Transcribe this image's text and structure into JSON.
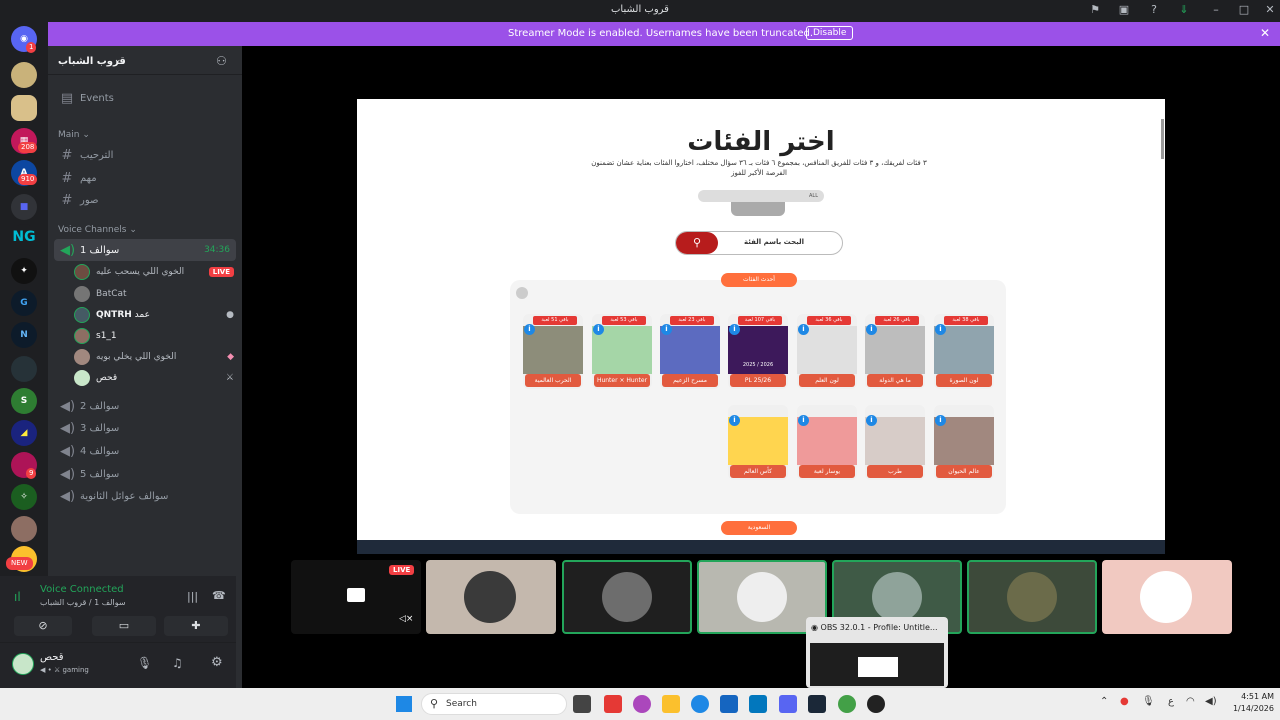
{
  "window": {
    "title": "قروب الشباب"
  },
  "banner": {
    "text": "Streamer Mode is enabled. Usernames have been truncated.",
    "disable_label": "Disable"
  },
  "servers": [
    {
      "badge": "1"
    },
    {
      "badge": ""
    },
    {
      "badge": ""
    },
    {
      "badge": "208"
    },
    {
      "badge": "910"
    },
    {
      "badge": ""
    },
    {
      "label": "NG"
    },
    {
      "badge": ""
    },
    {
      "badge": ""
    },
    {
      "badge": ""
    },
    {
      "badge": ""
    },
    {
      "badge": ""
    },
    {
      "badge": "9"
    },
    {
      "badge": ""
    },
    {
      "badge": ""
    },
    {
      "label": "NEW"
    }
  ],
  "sidebar": {
    "server_name": "قروب الشباب",
    "events_label": "Events",
    "main_category": "Main",
    "text_channels": [
      "الترحيب",
      "مهم",
      "صور"
    ],
    "voice_category": "Voice Channels",
    "active_voice": {
      "name": "سوالف 1",
      "timer": "34:36"
    },
    "voice_users": [
      {
        "name": "الخوي اللي يسحب عليه",
        "live": "LIVE"
      },
      {
        "name": "BatCat"
      },
      {
        "name": "QNTRH",
        "extra": "عمد"
      },
      {
        "name": "s1_1"
      },
      {
        "name": "الخوي اللي يخلي بويه"
      },
      {
        "name": "قحص"
      }
    ],
    "other_voice": [
      "سوالف 2",
      "سوالف 3",
      "سوالف 4",
      "سوالف 5",
      "سوالف عوائل الثانوية"
    ]
  },
  "voice_panel": {
    "status": "Voice Connected",
    "location": "سوالف 1 / قروب الشباب"
  },
  "user_panel": {
    "name": "قحص",
    "status": "gaming"
  },
  "stream": {
    "page_title": "اختر الفئات",
    "subtitle": "٣ فئات لفريقك، و ٣ فئات للفريق المنافس، بمجموع ٦ فئات بـ ٣٦ سؤال مختلف، اختاروا الفئات بعناية عشان تضمنون الفرصة الأكبر للفوز",
    "search_placeholder": "البحث باسم الفئة",
    "filter_all": "ALL",
    "section1": "أحدث الفئات",
    "section2": "السعودية",
    "categories_row1": [
      {
        "label": "الحرب العالمية",
        "tag": "باقي 51 لعبة"
      },
      {
        "label": "Hunter × Hunter",
        "tag": "باقي 53 لعبة"
      },
      {
        "label": "مسرح الزعيم",
        "tag": "باقي 23 لعبة"
      },
      {
        "label": "PL 25/26",
        "tag": "باقي 107 لعبة"
      },
      {
        "label": "لون العلم",
        "tag": "باقي 36 لعبة"
      },
      {
        "label": "ما هي الدولة",
        "tag": "باقي 26 لعبة"
      },
      {
        "label": "لون الصورة",
        "tag": "باقي 38 لعبة"
      }
    ],
    "categories_row2": [
      {
        "label": "كأس العالم"
      },
      {
        "label": "يوسار لعبة"
      },
      {
        "label": "طرب"
      },
      {
        "label": "عالم الحيوان"
      }
    ],
    "pl_caption": "2025 / 2026"
  },
  "participants": [
    {
      "live": "LIVE"
    },
    {},
    {},
    {},
    {},
    {},
    {}
  ],
  "obs": {
    "title": "OBS 32.0.1 - Profile: Untitle..."
  },
  "taskbar": {
    "search": "Search",
    "lang": "ع",
    "time": "4:51 AM",
    "date": "1/14/2026"
  }
}
